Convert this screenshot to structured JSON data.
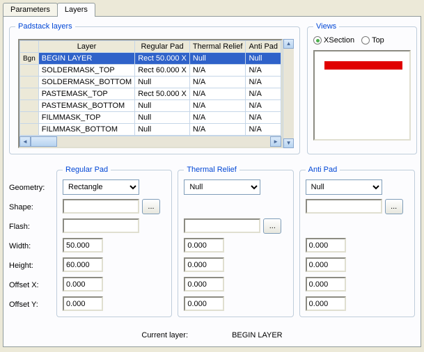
{
  "tabs": {
    "parameters": "Parameters",
    "layers": "Layers"
  },
  "padstack": {
    "legend": "Padstack layers",
    "headers": {
      "layer": "Layer",
      "regular": "Regular Pad",
      "thermal": "Thermal Relief",
      "anti": "Anti Pad"
    },
    "rowhdr": "Bgn",
    "rows": [
      {
        "layer": "BEGIN LAYER",
        "reg": "Rect 50.000 X",
        "th": "Null",
        "anti": "Null",
        "sel": true
      },
      {
        "layer": "SOLDERMASK_TOP",
        "reg": "Rect 60.000 X",
        "th": "N/A",
        "anti": "N/A"
      },
      {
        "layer": "SOLDERMASK_BOTTOM",
        "reg": "Null",
        "th": "N/A",
        "anti": "N/A"
      },
      {
        "layer": "PASTEMASK_TOP",
        "reg": "Rect 50.000 X",
        "th": "N/A",
        "anti": "N/A"
      },
      {
        "layer": "PASTEMASK_BOTTOM",
        "reg": "Null",
        "th": "N/A",
        "anti": "N/A"
      },
      {
        "layer": "FILMMASK_TOP",
        "reg": "Null",
        "th": "N/A",
        "anti": "N/A"
      },
      {
        "layer": "FILMMASK_BOTTOM",
        "reg": "Null",
        "th": "N/A",
        "anti": "N/A"
      }
    ]
  },
  "views": {
    "legend": "Views",
    "xsection": "XSection",
    "top": "Top"
  },
  "labels": {
    "geometry": "Geometry:",
    "shape": "Shape:",
    "flash": "Flash:",
    "width": "Width:",
    "height": "Height:",
    "offsetx": "Offset X:",
    "offsety": "Offset Y:"
  },
  "regular": {
    "legend": "Regular Pad",
    "geometry": "Rectangle",
    "shape": "",
    "flash": "",
    "width": "50.000",
    "height": "60.000",
    "ox": "0.000",
    "oy": "0.000",
    "browse": "..."
  },
  "thermal": {
    "legend": "Thermal Relief",
    "geometry": "Null",
    "flash": "",
    "width": "0.000",
    "height": "0.000",
    "ox": "0.000",
    "oy": "0.000",
    "browse": "..."
  },
  "anti": {
    "legend": "Anti Pad",
    "geometry": "Null",
    "shape": "",
    "width": "0.000",
    "height": "0.000",
    "ox": "0.000",
    "oy": "0.000",
    "browse": "..."
  },
  "footer": {
    "label": "Current layer:",
    "value": "BEGIN LAYER"
  }
}
